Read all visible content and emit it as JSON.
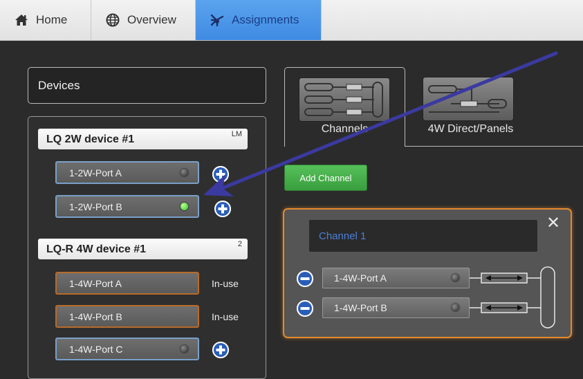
{
  "nav": {
    "tabs": [
      {
        "label": "Home",
        "icon": "home-icon"
      },
      {
        "label": "Overview",
        "icon": "globe-icon"
      },
      {
        "label": "Assignments",
        "icon": "assignments-icon",
        "active": true
      }
    ]
  },
  "devices": {
    "header": "Devices",
    "groups": [
      {
        "name": "LQ 2W device #1",
        "badge": "LM",
        "ports": [
          {
            "label": "1-2W-Port A",
            "led": "off"
          },
          {
            "label": "1-2W-Port B",
            "led": "green"
          }
        ]
      },
      {
        "name": "LQ-R 4W device #1",
        "badge": "2",
        "ports": [
          {
            "label": "1-4W-Port A",
            "status": "In-use"
          },
          {
            "label": "1-4W-Port B",
            "status": "In-use"
          },
          {
            "label": "1-4W-Port C",
            "led": "off"
          }
        ]
      }
    ]
  },
  "tabs": {
    "channels": "Channels",
    "direct": "4W Direct/Panels"
  },
  "add_channel_label": "Add Channel",
  "channel": {
    "name": "Channel 1",
    "close": "✕",
    "ports": [
      "1-4W-Port A",
      "1-4W-Port B"
    ]
  },
  "colors": {
    "accent_blue": "#3f8be3",
    "card_border": "#e38a2f",
    "add_green": "#3a9e3e",
    "led_green": "#2fc52f",
    "arrow": "#3b3aa0"
  }
}
